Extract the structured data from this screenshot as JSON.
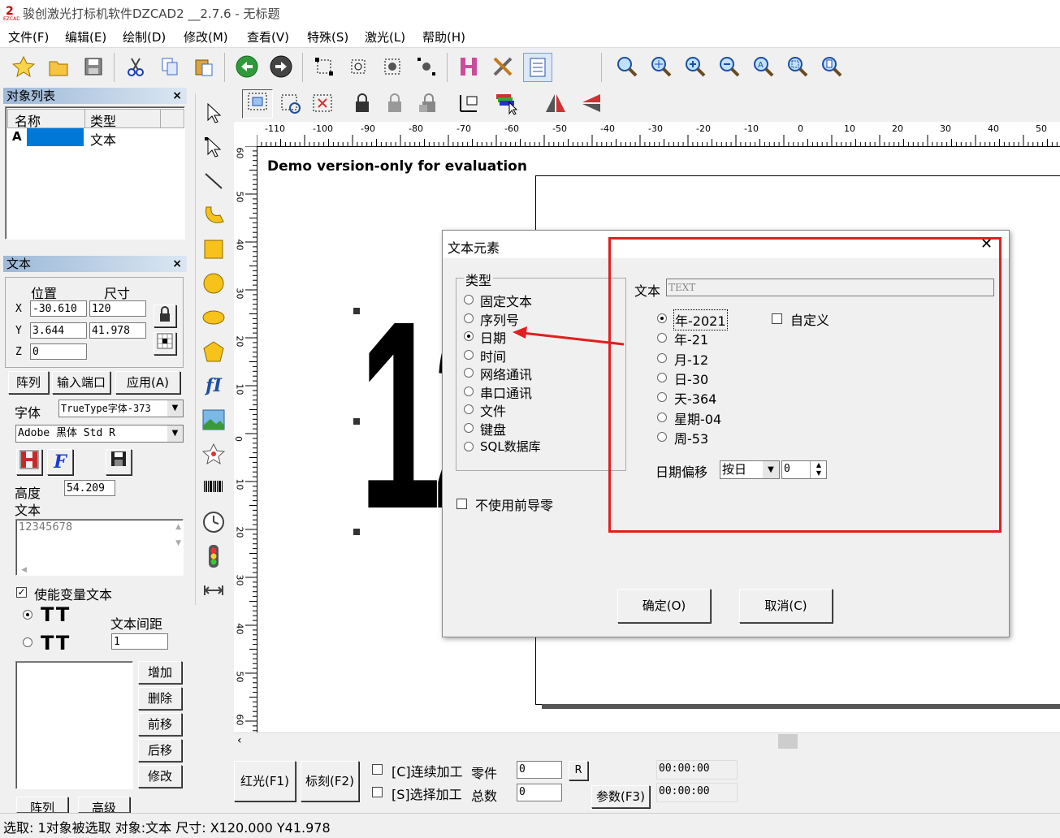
{
  "app": {
    "title": "骏创激光打标机软件DZCAD2 __2.7.6 - 无标题"
  },
  "menu": [
    "文件(F)",
    "编辑(E)",
    "绘制(D)",
    "修改(M)",
    "查看(V)",
    "特殊(S)",
    "激光(L)",
    "帮助(H)"
  ],
  "object_list": {
    "title": "对象列表",
    "headers": [
      "名称",
      "类型"
    ],
    "rows": [
      {
        "name": "A",
        "type": "文本"
      }
    ]
  },
  "text_panel": {
    "title": "文本",
    "position_label": "位置",
    "size_label": "尺寸",
    "x_label": "X",
    "y_label": "Y",
    "z_label": "Z",
    "x_value": "-30.610",
    "y_value": "3.644",
    "z_value": "0",
    "size_x": "120",
    "size_y": "41.978",
    "array_btn": "阵列",
    "port_btn": "输入端口",
    "apply_btn": "应用(A)",
    "font_label": "字体",
    "font_type": "TrueType字体-373",
    "font_name": "Adobe 黑体 Std R",
    "height_label": "高度",
    "height_value": "54.209",
    "text_label": "文本",
    "text_value": "12345678",
    "variable_label": "使能变量文本",
    "spacing_label": "文本间距",
    "spacing_value": "1",
    "add_btn": "增加",
    "delete_btn": "删除",
    "prev_btn": "前移",
    "next_btn": "后移",
    "modify_btn": "修改",
    "bottom_btn1": "阵列",
    "bottom_btn2": "高级"
  },
  "canvas": {
    "watermark": "Demo version-only for evaluation",
    "ruler_h": [
      "-110",
      "-100",
      "-90",
      "-80",
      "-70",
      "-60",
      "-50",
      "-40",
      "-30",
      "-20",
      "-10",
      "0",
      "10",
      "20",
      "30",
      "40",
      "50"
    ],
    "ruler_v": [
      "60",
      "50",
      "40",
      "30",
      "20",
      "10",
      "0",
      "10",
      "20",
      "30",
      "40",
      "50",
      "60"
    ],
    "big_text": "12"
  },
  "dialog": {
    "title": "文本元素",
    "type_group": "类型",
    "types": [
      "固定文本",
      "序列号",
      "日期",
      "时间",
      "网络通讯",
      "串口通讯",
      "文件",
      "键盘",
      "SQL数据库"
    ],
    "selected_type": "日期",
    "no_leading_zero": "不使用前导零",
    "text_label": "文本",
    "text_value": "TEXT",
    "date_options": [
      "年-2021",
      "年-21",
      "月-12",
      "日-30",
      "天-364",
      "星期-04",
      "周-53"
    ],
    "custom_label": "自定义",
    "offset_label": "日期偏移",
    "offset_unit": "按日",
    "offset_value": "0",
    "ok_btn": "确定(O)",
    "cancel_btn": "取消(C)",
    "highlight_color": "#e02020"
  },
  "bottom": {
    "red_light_btn": "红光(F1)",
    "mark_btn": "标刻(F2)",
    "continuous_label": "[C]连续加工",
    "select_label": "[S]选择加工",
    "parts_label": "零件",
    "total_label": "总数",
    "parts_value": "0",
    "total_value": "0",
    "r_btn": "R",
    "params_btn": "参数(F3)",
    "time1": "00:00:00",
    "time2": "00:00:00"
  },
  "status": "选取: 1对象被选取 对象:文本 尺寸: X120.000 Y41.978"
}
